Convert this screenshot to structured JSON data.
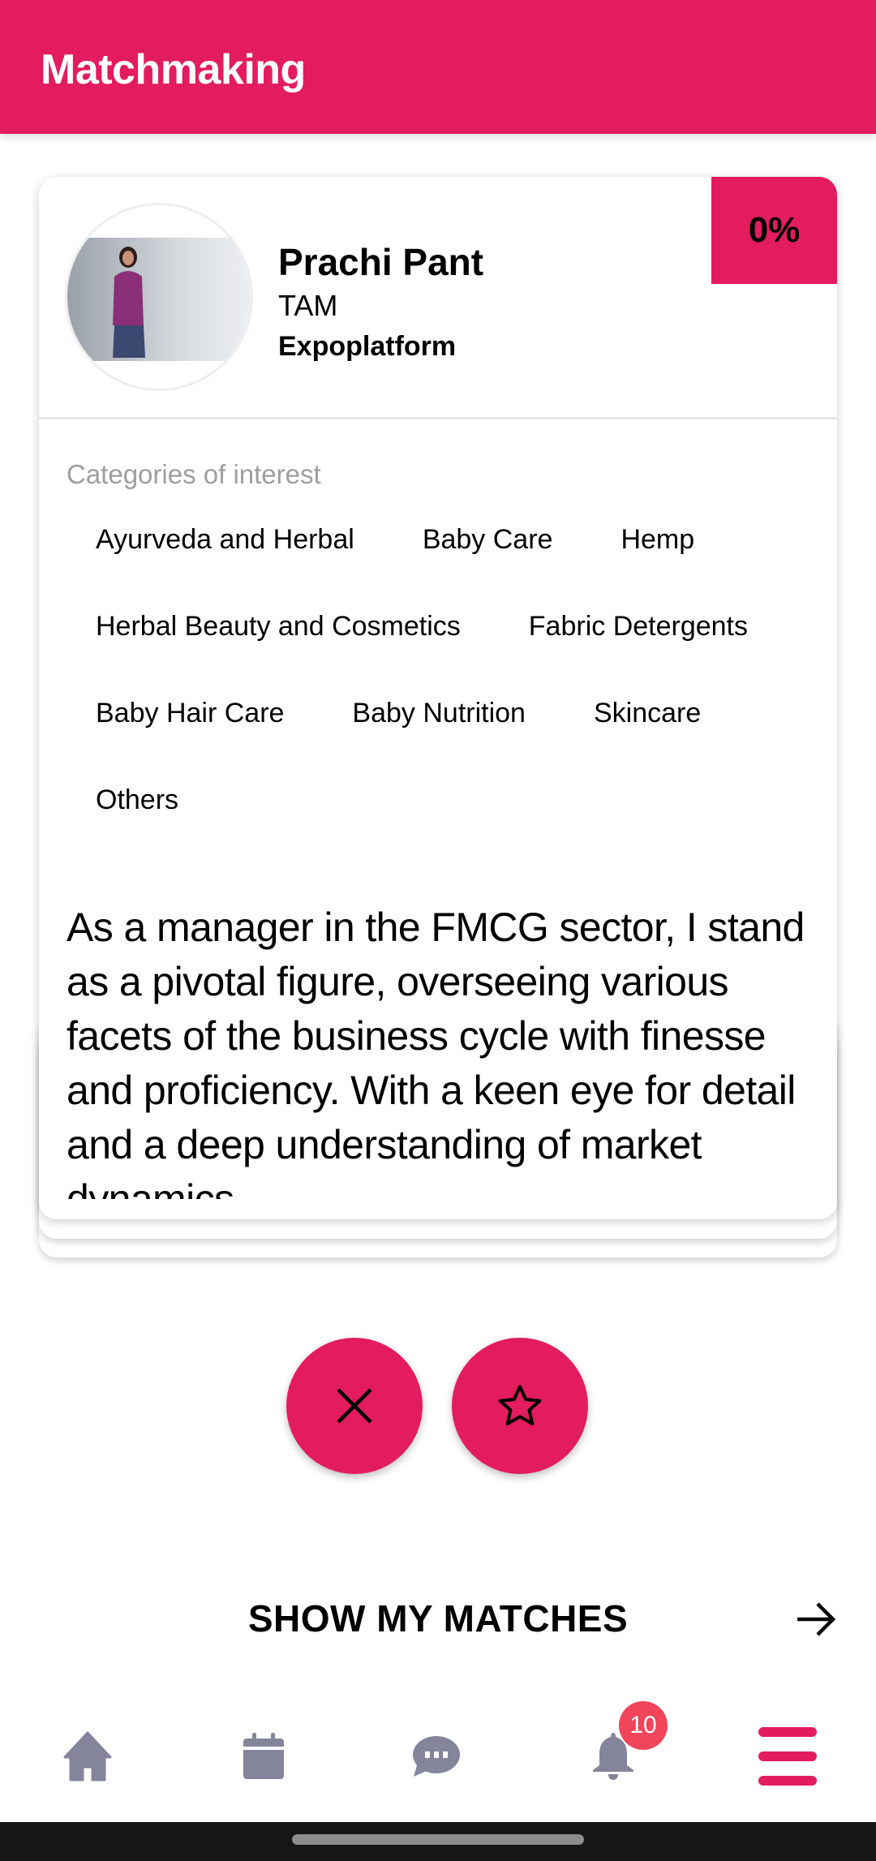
{
  "header": {
    "title": "Matchmaking"
  },
  "card": {
    "match_percent": "0%",
    "name": "Prachi Pant",
    "role": "TAM",
    "company": "Expoplatform",
    "categories_label": "Categories of interest",
    "categories": [
      "Ayurveda and Herbal",
      "Baby Care",
      "Hemp",
      "Herbal Beauty and Cosmetics",
      "Fabric Detergents",
      "Baby Hair Care",
      "Baby Nutrition",
      "Skincare",
      "Others"
    ],
    "description": "As a manager in the FMCG sector, I stand as a pivotal figure, overseeing various facets of the business cycle with finesse and proficiency. With a keen eye for detail and a deep understanding of market dynamics"
  },
  "actions": {
    "dismiss_icon": "close-icon",
    "favorite_icon": "star-icon"
  },
  "show_matches": {
    "label": "SHOW MY MATCHES",
    "icon": "arrow-right-icon"
  },
  "nav": {
    "items": [
      "home-icon",
      "calendar-icon",
      "chat-icon",
      "bell-icon",
      "menu-icon"
    ],
    "notification_count": "10"
  },
  "colors": {
    "accent": "#e31c5f",
    "nav_icon": "#84849a",
    "badge": "#f0455a"
  }
}
